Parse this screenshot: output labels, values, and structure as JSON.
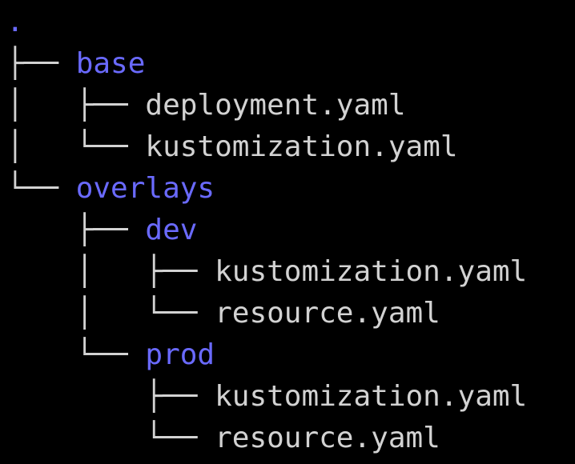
{
  "terminal": {
    "colors": {
      "background": "#000000",
      "directory": "#6a6aff",
      "file": "#d2d2d2",
      "branch": "#d2d2d2"
    },
    "lines": [
      {
        "branch": "",
        "name": ".",
        "kind": "dir"
      },
      {
        "branch": "├── ",
        "name": "base",
        "kind": "dir"
      },
      {
        "branch": "│   ├── ",
        "name": "deployment.yaml",
        "kind": "file"
      },
      {
        "branch": "│   └── ",
        "name": "kustomization.yaml",
        "kind": "file"
      },
      {
        "branch": "└── ",
        "name": "overlays",
        "kind": "dir"
      },
      {
        "branch": "    ├── ",
        "name": "dev",
        "kind": "dir"
      },
      {
        "branch": "    │   ├── ",
        "name": "kustomization.yaml",
        "kind": "file"
      },
      {
        "branch": "    │   └── ",
        "name": "resource.yaml",
        "kind": "file"
      },
      {
        "branch": "    └── ",
        "name": "prod",
        "kind": "dir"
      },
      {
        "branch": "        ├── ",
        "name": "kustomization.yaml",
        "kind": "file"
      },
      {
        "branch": "        └── ",
        "name": "resource.yaml",
        "kind": "file"
      }
    ]
  }
}
